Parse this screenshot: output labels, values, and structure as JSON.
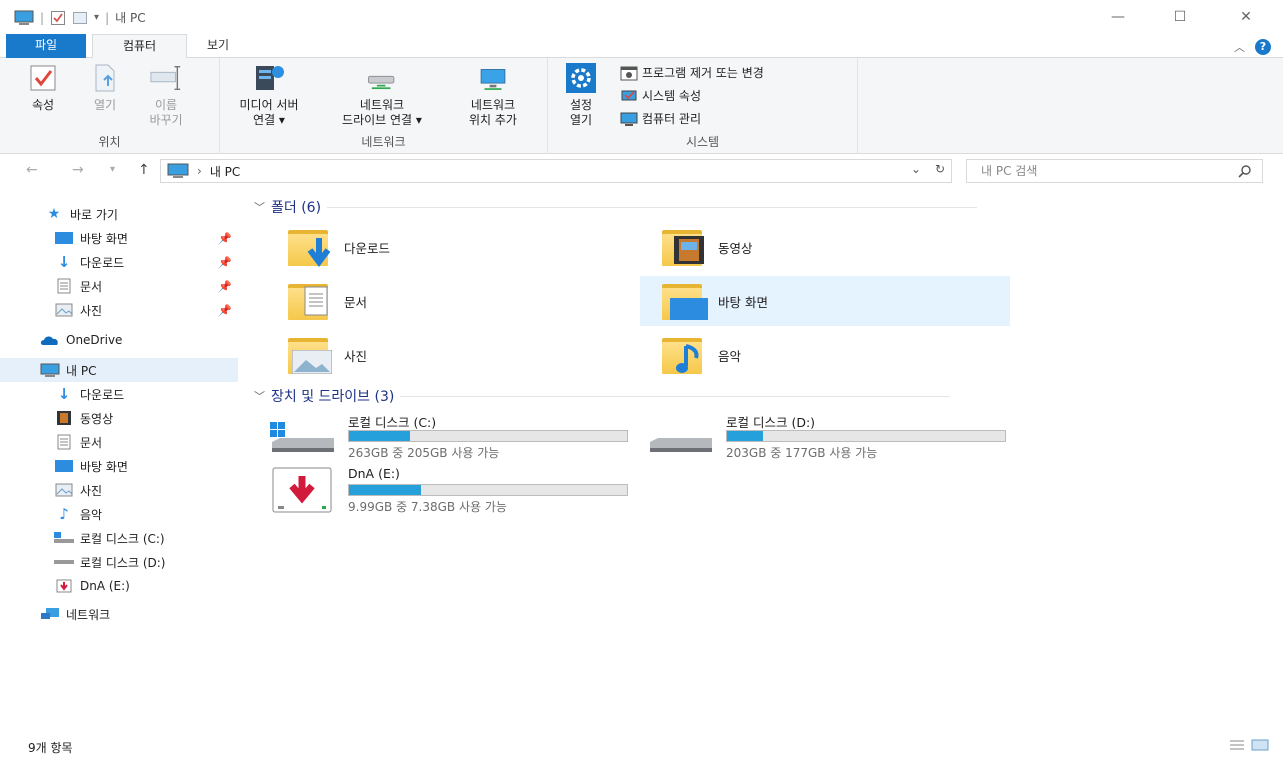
{
  "window": {
    "title": "내 PC",
    "controls": {
      "minimize": "—",
      "maximize": "☐",
      "close": "✕"
    }
  },
  "tabs": {
    "file": "파일",
    "computer": "컴퓨터",
    "view": "보기"
  },
  "ribbon": {
    "location": {
      "label": "위치",
      "properties": "속성",
      "open": "열기",
      "rename_1": "이름",
      "rename_2": "바꾸기"
    },
    "network": {
      "label": "네트워크",
      "media_server_1": "미디어 서버",
      "media_server_2": "연결 ▾",
      "map_drive_1": "네트워크",
      "map_drive_2": "드라이브 연결 ▾",
      "add_location_1": "네트워크",
      "add_location_2": "위치 추가"
    },
    "system": {
      "label": "시스템",
      "settings_1": "설정",
      "settings_2": "열기",
      "uninstall": "프로그램 제거 또는 변경",
      "sys_props": "시스템 속성",
      "manage": "컴퓨터 관리"
    }
  },
  "address": {
    "path_root": "내 PC",
    "search_placeholder": "내 PC 검색"
  },
  "nav": {
    "quick_access": "바로 가기",
    "qa_items": [
      "바탕 화면",
      "다운로드",
      "문서",
      "사진"
    ],
    "onedrive": "OneDrive",
    "this_pc": "내 PC",
    "pc_items": [
      "다운로드",
      "동영상",
      "문서",
      "바탕 화면",
      "사진",
      "음악",
      "로컬 디스크 (C:)",
      "로컬 디스크 (D:)",
      "DnA (E:)"
    ],
    "network": "네트워크"
  },
  "content": {
    "folders_header": "폴더 (6)",
    "folders": [
      "다운로드",
      "동영상",
      "문서",
      "바탕 화면",
      "사진",
      "음악"
    ],
    "drives_header": "장치 및 드라이브 (3)",
    "drives": [
      {
        "name": "로컬 디스크 (C:)",
        "free": "263GB 중 205GB 사용 가능",
        "used_fraction": 0.22
      },
      {
        "name": "로컬 디스크 (D:)",
        "free": "203GB 중 177GB 사용 가능",
        "used_fraction": 0.13
      },
      {
        "name": "DnA (E:)",
        "free": "9.99GB 중 7.38GB 사용 가능",
        "used_fraction": 0.26
      }
    ]
  },
  "status": {
    "count": "9개 항목"
  },
  "colors": {
    "accent": "#1979ca",
    "bar_fill": "#26a0da",
    "header_text": "#1e3287",
    "folder": "#f5c84a"
  }
}
